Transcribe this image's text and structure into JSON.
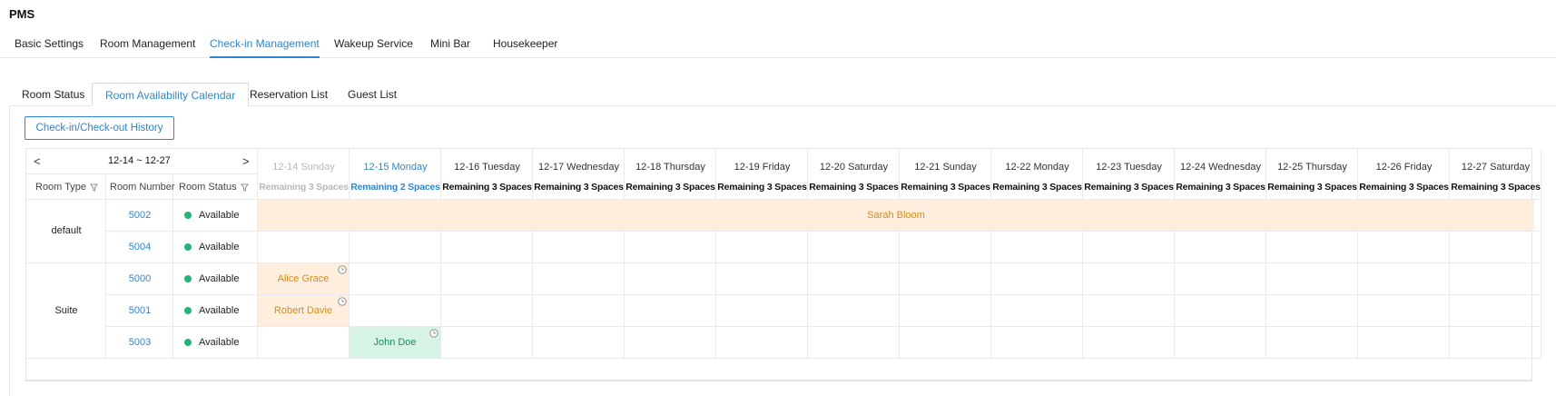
{
  "app": {
    "title": "PMS"
  },
  "top_tabs": [
    {
      "label": "Basic Settings"
    },
    {
      "label": "Room Management"
    },
    {
      "label": "Check-in Management"
    },
    {
      "label": "Wakeup Service"
    },
    {
      "label": "Mini Bar"
    },
    {
      "label": "Housekeeper"
    }
  ],
  "top_tab_active": "Check-in Management",
  "sub_tabs": [
    {
      "label": "Room Status"
    },
    {
      "label": "Room Availability Calendar"
    },
    {
      "label": "Reservation List"
    },
    {
      "label": "Guest List"
    }
  ],
  "sub_tab_active": "Room Availability Calendar",
  "history_button": "Check-in/Check-out History",
  "calendar": {
    "prev": "<",
    "next": ">",
    "range": "12-14 ~ 12-27",
    "col_room_type": "Room Type",
    "col_room_number": "Room Number",
    "col_room_status": "Room Status",
    "dates": [
      {
        "label": "12-14 Sunday",
        "spaces": "Remaining 3 Spaces",
        "state": "past"
      },
      {
        "label": "12-15 Monday",
        "spaces": "Remaining 2 Spaces",
        "state": "today"
      },
      {
        "label": "12-16 Tuesday",
        "spaces": "Remaining 3 Spaces",
        "state": "future"
      },
      {
        "label": "12-17 Wednesday",
        "spaces": "Remaining 3 Spaces",
        "state": "future"
      },
      {
        "label": "12-18 Thursday",
        "spaces": "Remaining 3 Spaces",
        "state": "future"
      },
      {
        "label": "12-19 Friday",
        "spaces": "Remaining 3 Spaces",
        "state": "future"
      },
      {
        "label": "12-20 Saturday",
        "spaces": "Remaining 3 Spaces",
        "state": "future"
      },
      {
        "label": "12-21 Sunday",
        "spaces": "Remaining 3 Spaces",
        "state": "future"
      },
      {
        "label": "12-22 Monday",
        "spaces": "Remaining 3 Spaces",
        "state": "future"
      },
      {
        "label": "12-23 Tuesday",
        "spaces": "Remaining 3 Spaces",
        "state": "future"
      },
      {
        "label": "12-24 Wednesday",
        "spaces": "Remaining 3 Spaces",
        "state": "future"
      },
      {
        "label": "12-25 Thursday",
        "spaces": "Remaining 3 Spaces",
        "state": "future"
      },
      {
        "label": "12-26 Friday",
        "spaces": "Remaining 3 Spaces",
        "state": "future"
      },
      {
        "label": "12-27 Saturday",
        "spaces": "Remaining 3 Spaces",
        "state": "future"
      }
    ],
    "room_types": [
      {
        "name": "default",
        "rows": 2
      },
      {
        "name": "Suite",
        "rows": 3
      }
    ],
    "rooms": [
      {
        "number": "5002",
        "status": "Available"
      },
      {
        "number": "5004",
        "status": "Available"
      },
      {
        "number": "5000",
        "status": "Available"
      },
      {
        "number": "5001",
        "status": "Available"
      },
      {
        "number": "5003",
        "status": "Available"
      }
    ],
    "bookings": [
      {
        "guest": "Sarah Bloom",
        "row": 0,
        "start_col": 0,
        "span": 14,
        "color": "orange",
        "clock": false
      },
      {
        "guest": "Alice Grace",
        "row": 2,
        "start_col": 0,
        "span": 1,
        "color": "orange",
        "clock": true
      },
      {
        "guest": "Robert Davie",
        "row": 3,
        "start_col": 0,
        "span": 1,
        "color": "orange",
        "clock": true
      },
      {
        "guest": "John Doe",
        "row": 4,
        "start_col": 1,
        "span": 1,
        "color": "green",
        "clock": true
      }
    ],
    "status_color": "#22b573",
    "accent_color": "#2d86d1"
  }
}
